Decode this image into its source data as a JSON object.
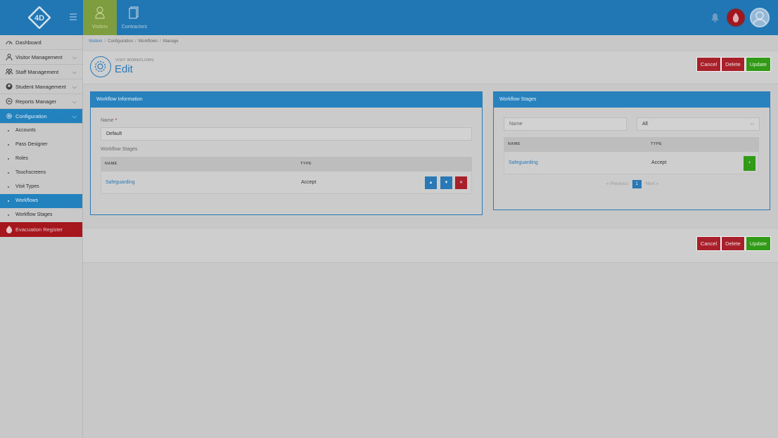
{
  "topbar": {
    "logo_text": "4D",
    "tabs": [
      {
        "label": "Visitors",
        "icon": "person-icon"
      },
      {
        "label": "Contractors",
        "icon": "document-icon"
      }
    ]
  },
  "sidebar": {
    "items": [
      {
        "label": "Dashboard",
        "icon": "dashboard-icon"
      },
      {
        "label": "Visitor Management",
        "icon": "person-icon"
      },
      {
        "label": "Staff Management",
        "icon": "staff-icon"
      },
      {
        "label": "Student Management",
        "icon": "student-icon"
      },
      {
        "label": "Reports Manager",
        "icon": "reports-icon"
      },
      {
        "label": "Configuration",
        "icon": "gear-icon"
      }
    ],
    "sub_items": [
      "Accounts",
      "Pass Designer",
      "Roles",
      "Touchscreens",
      "Visit Types",
      "Workflows",
      "Workflow Stages"
    ],
    "evacuation": "Evacuation Register"
  },
  "breadcrumb": [
    "Visitors",
    "Configuration",
    "Workflows",
    "Manage"
  ],
  "page": {
    "subtitle": "VISIT WORKFLOWS",
    "title": "Edit"
  },
  "actions": {
    "cancel": "Cancel",
    "delete": "Delete",
    "update": "Update"
  },
  "workflow_info": {
    "heading": "Workflow Information",
    "name_label": "Name",
    "required_mark": "*",
    "name_value": "Default",
    "stages_label": "Workflow Stages",
    "columns": [
      "NAME",
      "TYPE"
    ],
    "rows": [
      {
        "name": "Safeguarding",
        "type": "Accept"
      }
    ]
  },
  "workflow_stages": {
    "heading": "Workflow Stages",
    "search_placeholder": "Name",
    "filter_value": "All",
    "columns": [
      "NAME",
      "TYPE"
    ],
    "rows": [
      {
        "name": "Safeguarding",
        "type": "Accept"
      }
    ],
    "pager": {
      "previous": "Previous",
      "page": "1",
      "next": "Next"
    }
  },
  "colors": {
    "brand": "#2177b4",
    "danger": "#a8202a",
    "success": "#319a16"
  }
}
